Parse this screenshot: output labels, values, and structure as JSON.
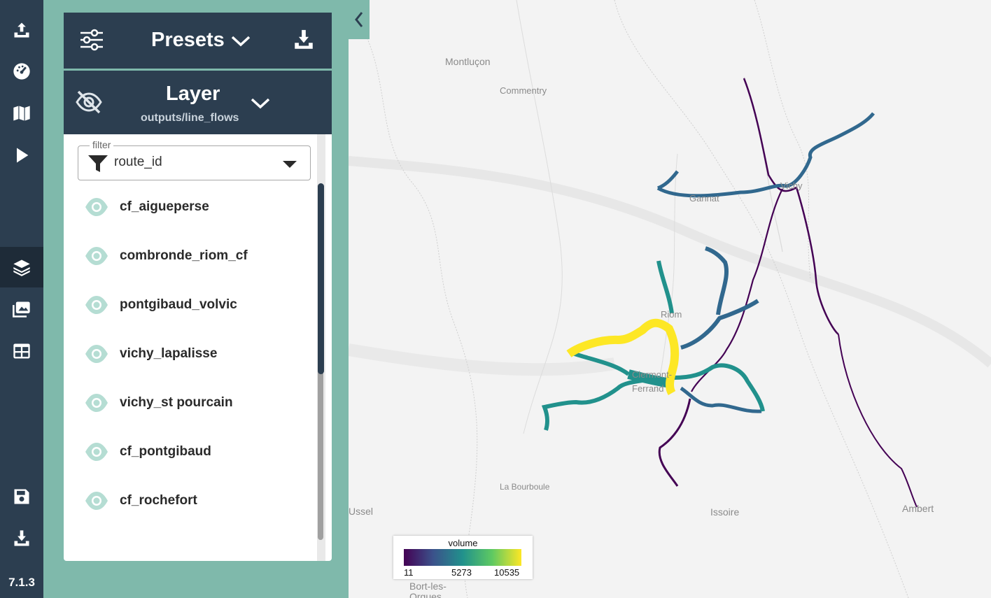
{
  "app": {
    "version": "7.1.3"
  },
  "sidebar": {
    "items": [
      {
        "name": "upload",
        "icon": "upload-icon"
      },
      {
        "name": "dashboard",
        "icon": "gauge-icon"
      },
      {
        "name": "map",
        "icon": "map-icon"
      },
      {
        "name": "run",
        "icon": "play-icon"
      },
      {
        "name": "layers",
        "icon": "layers-icon",
        "active": true
      },
      {
        "name": "images",
        "icon": "images-icon"
      },
      {
        "name": "table",
        "icon": "table-icon"
      },
      {
        "name": "save",
        "icon": "save-icon"
      },
      {
        "name": "download",
        "icon": "download-icon"
      }
    ]
  },
  "presets": {
    "title": "Presets"
  },
  "layer": {
    "title": "Layer",
    "subtitle": "outputs/line_flows"
  },
  "filter": {
    "legend": "filter",
    "value": "route_id"
  },
  "routes": [
    {
      "label": "cf_aigueperse"
    },
    {
      "label": "combronde_riom_cf"
    },
    {
      "label": "pontgibaud_volvic"
    },
    {
      "label": "vichy_lapalisse"
    },
    {
      "label": "vichy_st pourcain"
    },
    {
      "label": "cf_pontgibaud"
    },
    {
      "label": "cf_rochefort"
    }
  ],
  "map": {
    "places": [
      "Montluçon",
      "Commentry",
      "Gannat",
      "Vichy",
      "Riom",
      "Clermont-Ferrand",
      "La Bourboule",
      "Issoire",
      "Ambert",
      "Ussel",
      "Bort-les-Orgues"
    ],
    "legend": {
      "title": "volume",
      "min": "11",
      "mid": "5273",
      "max": "10535"
    }
  },
  "colors": {
    "rail": "#2c3e50",
    "panel": "#7fb9ab",
    "eye": "#b5ddd3",
    "yellow": "#fde725",
    "teal": "#21918c",
    "blue": "#31688e",
    "purple": "#440154"
  }
}
